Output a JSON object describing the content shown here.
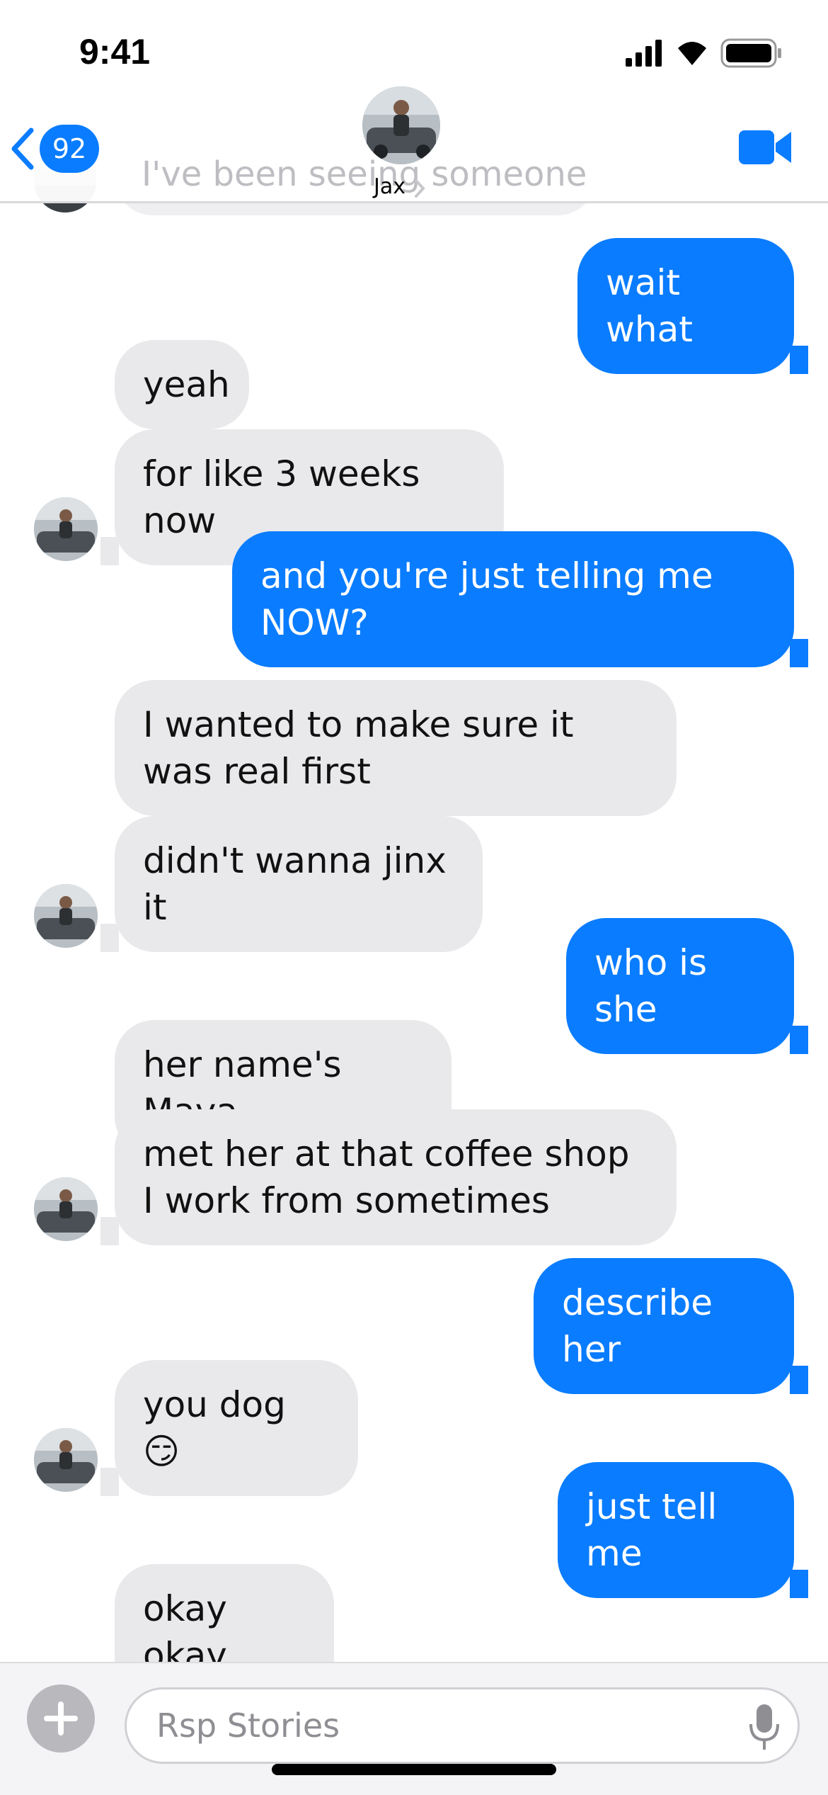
{
  "status_bar": {
    "time": "9:41"
  },
  "header": {
    "back_badge_count": "92",
    "contact_name": "Jax",
    "accent_color": "#0a7cff"
  },
  "ghost_message": {
    "text": "I've been seeing someone"
  },
  "messages": [
    {
      "sender": "me",
      "text": "wait what"
    },
    {
      "sender": "contact",
      "text": "yeah"
    },
    {
      "sender": "contact",
      "text": "for like 3 weeks now"
    },
    {
      "sender": "me",
      "text": "and you're just telling me NOW?"
    },
    {
      "sender": "contact",
      "text": "I wanted to make sure it was real first"
    },
    {
      "sender": "contact",
      "text": "didn't wanna jinx it"
    },
    {
      "sender": "me",
      "text": "who is she"
    },
    {
      "sender": "contact",
      "text": "her name's Maya"
    },
    {
      "sender": "contact",
      "text": "met her at that coffee shop I work from sometimes"
    },
    {
      "sender": "me",
      "text": "describe her"
    },
    {
      "sender": "contact",
      "text": "you dog 😏"
    },
    {
      "sender": "me",
      "text": "just tell me"
    },
    {
      "sender": "contact",
      "text": "okay okay"
    }
  ],
  "composer": {
    "placeholder": "Rsp Stories"
  },
  "icons": [
    "signal-icon",
    "wifi-icon",
    "battery-icon",
    "back-chevron-icon",
    "video-call-icon",
    "plus-icon",
    "microphone-icon"
  ]
}
